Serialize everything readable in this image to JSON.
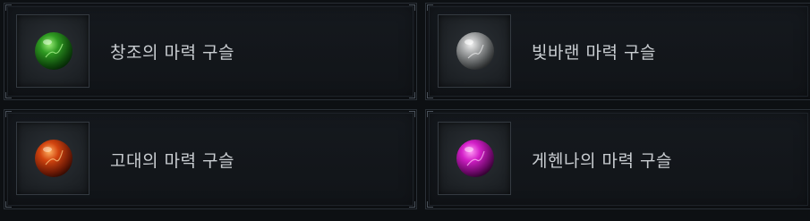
{
  "items": [
    {
      "label": "창조의 마력 구슬",
      "orb_color": "#2f9a22",
      "icon": "green-orb-icon"
    },
    {
      "label": "빛바랜 마력 구슬",
      "orb_color": "#a7a9aa",
      "icon": "gray-orb-icon"
    },
    {
      "label": "고대의 마력 구슬",
      "orb_color": "#d2440f",
      "icon": "orange-orb-icon"
    },
    {
      "label": "게헨나의 마력 구슬",
      "orb_color": "#d31fc8",
      "icon": "magenta-orb-icon"
    }
  ]
}
